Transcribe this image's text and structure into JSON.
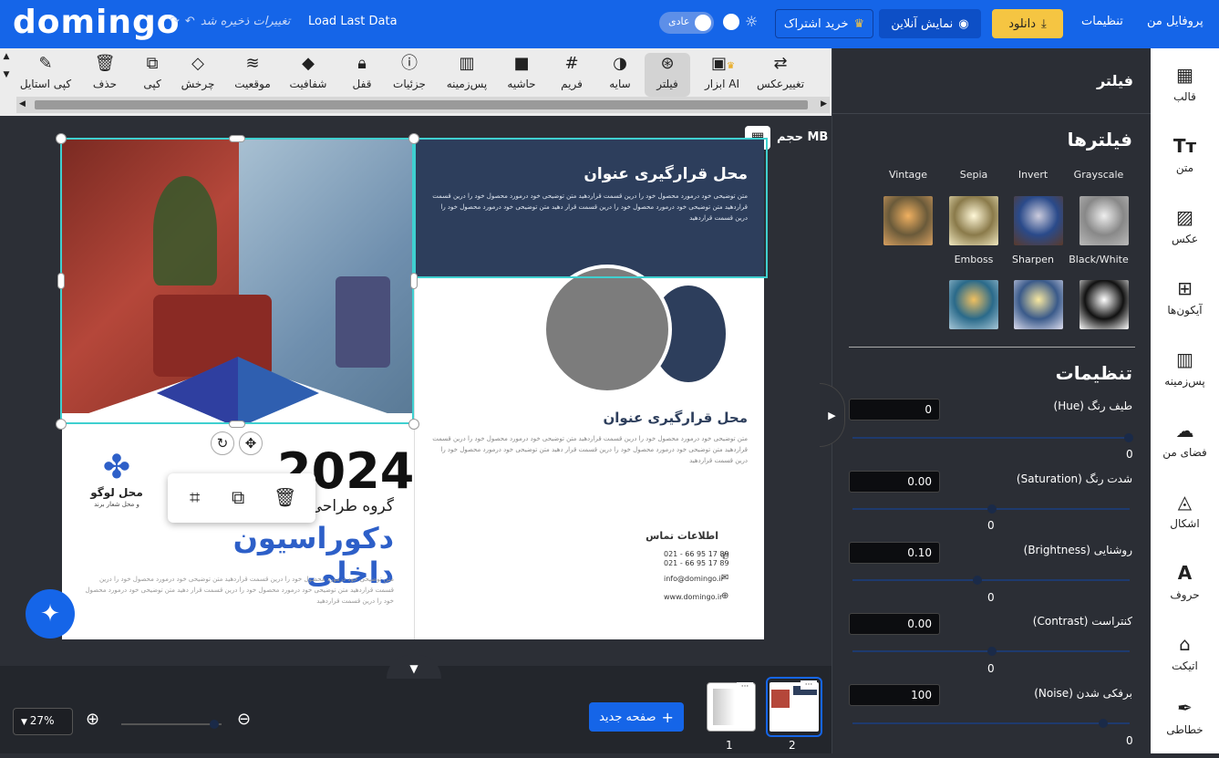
{
  "topbar": {
    "brand": "domingo",
    "unsaved": "تغییرات ذخیره شد",
    "load_last": "Load Last Data",
    "mode_label": "عادی",
    "buy_label": "خرید اشتراک",
    "preview_label": "نمایش آنلاین",
    "download_label": "دانلود",
    "settings_label": "تنظیمات",
    "profile_label": "پروفایل من"
  },
  "toolbar": {
    "items": [
      {
        "label": "تغییرعکس",
        "icon": "swap-image-icon"
      },
      {
        "label": "ابزار AI",
        "icon": "ai-icon"
      },
      {
        "label": "فیلتر",
        "icon": "filter-icon"
      },
      {
        "label": "سایه",
        "icon": "shadow-icon"
      },
      {
        "label": "فریم",
        "icon": "frame-icon"
      },
      {
        "label": "حاشیه",
        "icon": "border-icon"
      },
      {
        "label": "پس‌زمینه",
        "icon": "background-icon"
      },
      {
        "label": "جزئیات",
        "icon": "info-icon"
      },
      {
        "label": "قفل",
        "icon": "lock-icon"
      },
      {
        "label": "شفافیت",
        "icon": "opacity-icon"
      },
      {
        "label": "موقعیت",
        "icon": "layers-icon"
      },
      {
        "label": "چرخش",
        "icon": "rotate-icon"
      },
      {
        "label": "کپی",
        "icon": "copy-icon"
      },
      {
        "label": "حذف",
        "icon": "trash-icon"
      },
      {
        "label": "کپی استایل",
        "icon": "brush-icon"
      }
    ]
  },
  "canvas": {
    "size_label": "حجم MB",
    "doc": {
      "title1": "محل قرارگیری عنوان",
      "body_text": "متن توضیحی خود درمورد محصول خود را درین قسمت قراردهید متن توضیحی خود درمورد محصول خود را درین قسمت قراردهید متن توضیحی خود درمورد محصول خود را درین قسمت قرار دهید متن توضیحی خود درمورد محصول خود را درین قسمت قراردهید",
      "title2": "محل قرارگیری عنوان",
      "year": "2024",
      "subtitle": "گروه طراحی",
      "headline": "دکوراسیون داخلی",
      "logo_title": "محل لوگو",
      "logo_sub": "و محل شعار برند",
      "contact_title": "اطلاعات تماس",
      "phone1": "021 - 66 95 17 89",
      "phone2": "021 - 66 95 17 89",
      "email": "info@domingo.ir",
      "site": "www.domingo.ir"
    }
  },
  "bottom": {
    "zoom": "27%",
    "new_page": "صفحه جدید",
    "pages": [
      "1",
      "2"
    ]
  },
  "panel": {
    "header": "فیلتر",
    "filters_title": "فیلترها",
    "filters": [
      "Grayscale",
      "Invert",
      "Sepia",
      "Vintage",
      "Black/White",
      "Sharpen",
      "Emboss"
    ],
    "settings_title": "تنظیمات",
    "sliders": [
      {
        "label": "طیف رنگ (Hue)",
        "value": "0",
        "min": "0",
        "pos": 0.99
      },
      {
        "label": "شدت رنگ (Saturation)",
        "value": "0.00",
        "min": "0",
        "pos": 0.5
      },
      {
        "label": "روشنایی (Brightness)",
        "value": "0.10",
        "min": "0",
        "pos": 0.45
      },
      {
        "label": "کنتراست (Contrast)",
        "value": "0.00",
        "min": "0",
        "pos": 0.5
      },
      {
        "label": "برفکی شدن (Noise)",
        "value": "100",
        "min": "0",
        "pos": 0.9
      }
    ]
  },
  "sidebar": {
    "items": [
      {
        "label": "قالب",
        "icon": "template-icon"
      },
      {
        "label": "متن",
        "icon": "text-icon"
      },
      {
        "label": "عکس",
        "icon": "image-icon"
      },
      {
        "label": "آیکون‌ها",
        "icon": "icons-grid-icon"
      },
      {
        "label": "پس‌زمینه",
        "icon": "background-icon"
      },
      {
        "label": "فضای من",
        "icon": "cloud-upload-icon"
      },
      {
        "label": "اشکال",
        "icon": "shapes-icon"
      },
      {
        "label": "حروف",
        "icon": "letters-icon"
      },
      {
        "label": "اتیکت",
        "icon": "tag-icon"
      },
      {
        "label": "خطاطی",
        "icon": "calligraphy-icon"
      }
    ]
  },
  "colors": {
    "accent": "#1565e8",
    "download": "#f5c542",
    "navy": "#2d3e5c",
    "selection": "#3fd0d0"
  }
}
